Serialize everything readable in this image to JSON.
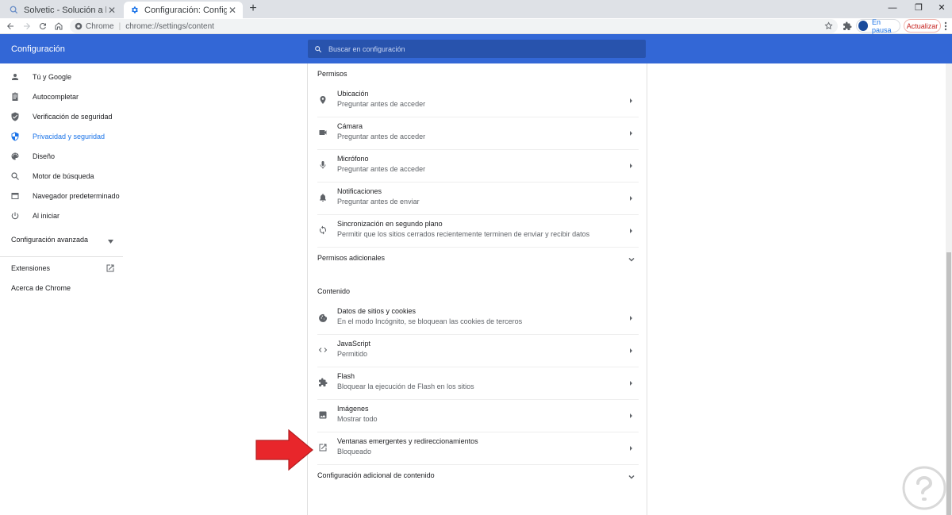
{
  "tabs": [
    {
      "title": "Solvetic - Solución a los problem",
      "favicon": "solvetic-icon",
      "active": false
    },
    {
      "title": "Configuración: Configuración de",
      "favicon": "gear-icon",
      "active": true
    }
  ],
  "toolbar": {
    "site_label": "Chrome",
    "url": "chrome://settings/content",
    "profile_label": "En pausa",
    "update_label": "Actualizar"
  },
  "header": {
    "title": "Configuración",
    "search_placeholder": "Buscar en configuración"
  },
  "sidebar": {
    "items": [
      {
        "label": "Tú y Google",
        "icon": "person-icon"
      },
      {
        "label": "Autocompletar",
        "icon": "clipboard-icon"
      },
      {
        "label": "Verificación de seguridad",
        "icon": "shield-check-icon"
      },
      {
        "label": "Privacidad y seguridad",
        "icon": "shield-icon",
        "selected": true
      },
      {
        "label": "Diseño",
        "icon": "palette-icon"
      },
      {
        "label": "Motor de búsqueda",
        "icon": "search-icon"
      },
      {
        "label": "Navegador predeterminado",
        "icon": "browser-icon"
      },
      {
        "label": "Al iniciar",
        "icon": "power-icon"
      }
    ],
    "advanced_label": "Configuración avanzada",
    "extensions_label": "Extensiones",
    "about_label": "Acerca de Chrome"
  },
  "main": {
    "permissions_header": "Permisos",
    "permissions": [
      {
        "title": "Ubicación",
        "subtitle": "Preguntar antes de acceder",
        "icon": "location-pin-icon"
      },
      {
        "title": "Cámara",
        "subtitle": "Preguntar antes de acceder",
        "icon": "camera-icon"
      },
      {
        "title": "Micrófono",
        "subtitle": "Preguntar antes de acceder",
        "icon": "microphone-icon"
      },
      {
        "title": "Notificaciones",
        "subtitle": "Preguntar antes de enviar",
        "icon": "bell-icon"
      },
      {
        "title": "Sincronización en segundo plano",
        "subtitle": "Permitir que los sitios cerrados recientemente terminen de enviar y recibir datos",
        "icon": "sync-icon"
      }
    ],
    "additional_permissions_label": "Permisos adicionales",
    "content_header": "Contenido",
    "content": [
      {
        "title": "Datos de sitios y cookies",
        "subtitle": "En el modo Incógnito, se bloquean las cookies de terceros",
        "icon": "cookie-icon"
      },
      {
        "title": "JavaScript",
        "subtitle": "Permitido",
        "icon": "code-icon"
      },
      {
        "title": "Flash",
        "subtitle": "Bloquear la ejecución de Flash en los sitios",
        "icon": "puzzle-icon"
      },
      {
        "title": "Imágenes",
        "subtitle": "Mostrar todo",
        "icon": "image-icon"
      },
      {
        "title": "Ventanas emergentes y redireccionamientos",
        "subtitle": "Bloqueado",
        "icon": "open-in-new-icon"
      }
    ],
    "additional_content_label": "Configuración adicional de contenido"
  },
  "colors": {
    "header_bg": "#3367d6",
    "accent": "#1a73e8",
    "annotation_arrow": "#e8262b"
  }
}
